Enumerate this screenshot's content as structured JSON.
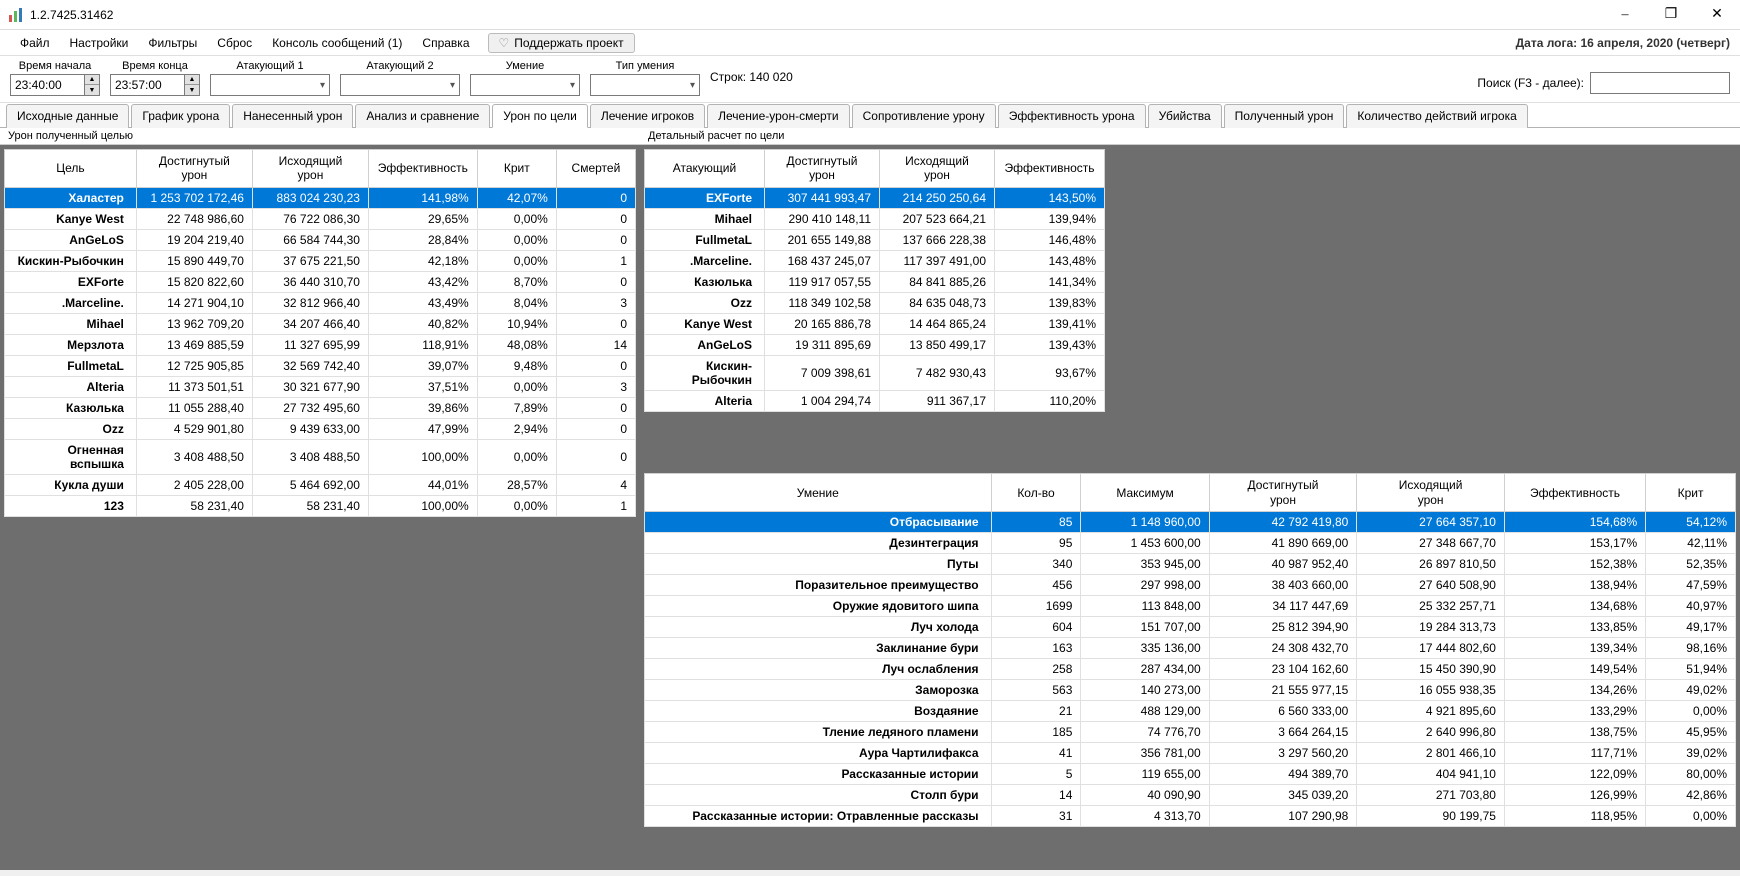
{
  "window": {
    "title": "1.2.7425.31462"
  },
  "menu": {
    "file": "Файл",
    "settings": "Настройки",
    "filters": "Фильтры",
    "reset": "Сброс",
    "console": "Консоль сообщений (1)",
    "help": "Справка",
    "support": "Поддержать проект",
    "log_date": "Дата лога: 16 апреля, 2020  (четверг)"
  },
  "filters": {
    "start_label": "Время начала",
    "start_value": "23:40:00",
    "end_label": "Время конца",
    "end_value": "23:57:00",
    "attacker1_label": "Атакующий 1",
    "attacker2_label": "Атакующий 2",
    "skill_label": "Умение",
    "skill_type_label": "Тип умения",
    "rows": "Строк: 140 020",
    "search_label": "Поиск (F3 - далее):"
  },
  "tabs": [
    "Исходные данные",
    "График урона",
    "Нанесенный урон",
    "Анализ и сравнение",
    "Урон по цели",
    "Лечение игроков",
    "Лечение-урон-смерти",
    "Сопротивление урону",
    "Эффективность урона",
    "Убийства",
    "Полученный урон",
    "Количество действий игрока"
  ],
  "active_tab": 4,
  "panels": {
    "left_title": "Урон полученный целью",
    "right_top_title": "Детальный расчет по цели"
  },
  "table_left": {
    "headers": [
      "Цель",
      "Достигнутый урон",
      "Исходящий урон",
      "Эффективность",
      "Крит",
      "Смертей"
    ],
    "rows": [
      {
        "sel": true,
        "c": [
          "Халастер",
          "1 253 702 172,46",
          "883 024 230,23",
          "141,98%",
          "42,07%",
          "0"
        ]
      },
      {
        "c": [
          "Kanye West",
          "22 748 986,60",
          "76 722 086,30",
          "29,65%",
          "0,00%",
          "0"
        ]
      },
      {
        "c": [
          "AnGeLoS",
          "19 204 219,40",
          "66 584 744,30",
          "28,84%",
          "0,00%",
          "0"
        ]
      },
      {
        "c": [
          "Кискин-Рыбочкин",
          "15 890 449,70",
          "37 675 221,50",
          "42,18%",
          "0,00%",
          "1"
        ]
      },
      {
        "c": [
          "EXForte",
          "15 820 822,60",
          "36 440 310,70",
          "43,42%",
          "8,70%",
          "0"
        ]
      },
      {
        "c": [
          ".Marceline.",
          "14 271 904,10",
          "32 812 966,40",
          "43,49%",
          "8,04%",
          "3"
        ]
      },
      {
        "c": [
          "Mihael",
          "13 962 709,20",
          "34 207 466,40",
          "40,82%",
          "10,94%",
          "0"
        ]
      },
      {
        "c": [
          "Мерзлота",
          "13 469 885,59",
          "11 327 695,99",
          "118,91%",
          "48,08%",
          "14"
        ]
      },
      {
        "c": [
          "FullmetaL",
          "12 725 905,85",
          "32 569 742,40",
          "39,07%",
          "9,48%",
          "0"
        ]
      },
      {
        "c": [
          "Alteria",
          "11 373 501,51",
          "30 321 677,90",
          "37,51%",
          "0,00%",
          "3"
        ]
      },
      {
        "c": [
          "Казюлька",
          "11 055 288,40",
          "27 732 495,60",
          "39,86%",
          "7,89%",
          "0"
        ]
      },
      {
        "c": [
          "Ozz",
          "4 529 901,80",
          "9 439 633,00",
          "47,99%",
          "2,94%",
          "0"
        ]
      },
      {
        "c": [
          "Огненная вспышка",
          "3 408 488,50",
          "3 408 488,50",
          "100,00%",
          "0,00%",
          "0"
        ]
      },
      {
        "c": [
          "Кукла души",
          "2 405 228,00",
          "5 464 692,00",
          "44,01%",
          "28,57%",
          "4"
        ]
      },
      {
        "c": [
          "123",
          "58 231,40",
          "58 231,40",
          "100,00%",
          "0,00%",
          "1"
        ]
      }
    ]
  },
  "table_right_top": {
    "headers": [
      "Атакующий",
      "Достигнутый урон",
      "Исходящий урон",
      "Эффективность"
    ],
    "rows": [
      {
        "sel": true,
        "c": [
          "EXForte",
          "307 441 993,47",
          "214 250 250,64",
          "143,50%"
        ]
      },
      {
        "c": [
          "Mihael",
          "290 410 148,11",
          "207 523 664,21",
          "139,94%"
        ]
      },
      {
        "c": [
          "FullmetaL",
          "201 655 149,88",
          "137 666 228,38",
          "146,48%"
        ]
      },
      {
        "c": [
          ".Marceline.",
          "168 437 245,07",
          "117 397 491,00",
          "143,48%"
        ]
      },
      {
        "c": [
          "Казюлька",
          "119 917 057,55",
          "84 841 885,26",
          "141,34%"
        ]
      },
      {
        "c": [
          "Ozz",
          "118 349 102,58",
          "84 635 048,73",
          "139,83%"
        ]
      },
      {
        "c": [
          "Kanye West",
          "20 165 886,78",
          "14 464 865,24",
          "139,41%"
        ]
      },
      {
        "c": [
          "AnGeLoS",
          "19 311 895,69",
          "13 850 499,17",
          "139,43%"
        ]
      },
      {
        "c": [
          "Кискин-Рыбочкин",
          "7 009 398,61",
          "7 482 930,43",
          "93,67%"
        ]
      },
      {
        "c": [
          "Alteria",
          "1 004 294,74",
          "911 367,17",
          "110,20%"
        ]
      }
    ]
  },
  "table_right_bottom": {
    "headers": [
      "Умение",
      "Кол-во",
      "Максимум",
      "Достигнутый урон",
      "Исходящий урон",
      "Эффективность",
      "Крит"
    ],
    "rows": [
      {
        "sel": true,
        "c": [
          "Отбрасывание",
          "85",
          "1 148 960,00",
          "42 792 419,80",
          "27 664 357,10",
          "154,68%",
          "54,12%"
        ]
      },
      {
        "c": [
          "Дезинтеграция",
          "95",
          "1 453 600,00",
          "41 890 669,00",
          "27 348 667,70",
          "153,17%",
          "42,11%"
        ]
      },
      {
        "c": [
          "Путы",
          "340",
          "353 945,00",
          "40 987 952,40",
          "26 897 810,50",
          "152,38%",
          "52,35%"
        ]
      },
      {
        "c": [
          "Поразительное преимущество",
          "456",
          "297 998,00",
          "38 403 660,00",
          "27 640 508,90",
          "138,94%",
          "47,59%"
        ]
      },
      {
        "c": [
          "Оружие ядовитого шипа",
          "1699",
          "113 848,00",
          "34 117 447,69",
          "25 332 257,71",
          "134,68%",
          "40,97%"
        ]
      },
      {
        "c": [
          "Луч холода",
          "604",
          "151 707,00",
          "25 812 394,90",
          "19 284 313,73",
          "133,85%",
          "49,17%"
        ]
      },
      {
        "c": [
          "Заклинание бури",
          "163",
          "335 136,00",
          "24 308 432,70",
          "17 444 802,60",
          "139,34%",
          "98,16%"
        ]
      },
      {
        "c": [
          "Луч ослабления",
          "258",
          "287 434,00",
          "23 104 162,60",
          "15 450 390,90",
          "149,54%",
          "51,94%"
        ]
      },
      {
        "c": [
          "Заморозка",
          "563",
          "140 273,00",
          "21 555 977,15",
          "16 055 938,35",
          "134,26%",
          "49,02%"
        ]
      },
      {
        "c": [
          "Воздаяние",
          "21",
          "488 129,00",
          "6 560 333,00",
          "4 921 895,60",
          "133,29%",
          "0,00%"
        ]
      },
      {
        "c": [
          "Тление ледяного пламени",
          "185",
          "74 776,70",
          "3 664 264,15",
          "2 640 996,80",
          "138,75%",
          "45,95%"
        ]
      },
      {
        "c": [
          "Аура Чартилифакса",
          "41",
          "356 781,00",
          "3 297 560,20",
          "2 801 466,10",
          "117,71%",
          "39,02%"
        ]
      },
      {
        "c": [
          "Рассказанные истории",
          "5",
          "119 655,00",
          "494 389,70",
          "404 941,10",
          "122,09%",
          "80,00%"
        ]
      },
      {
        "c": [
          "Столп бури",
          "14",
          "40 090,90",
          "345 039,20",
          "271 703,80",
          "126,99%",
          "42,86%"
        ]
      },
      {
        "c": [
          "Рассказанные истории: Отравленные рассказы",
          "31",
          "4 313,70",
          "107 290,98",
          "90 199,75",
          "118,95%",
          "0,00%"
        ]
      }
    ]
  }
}
